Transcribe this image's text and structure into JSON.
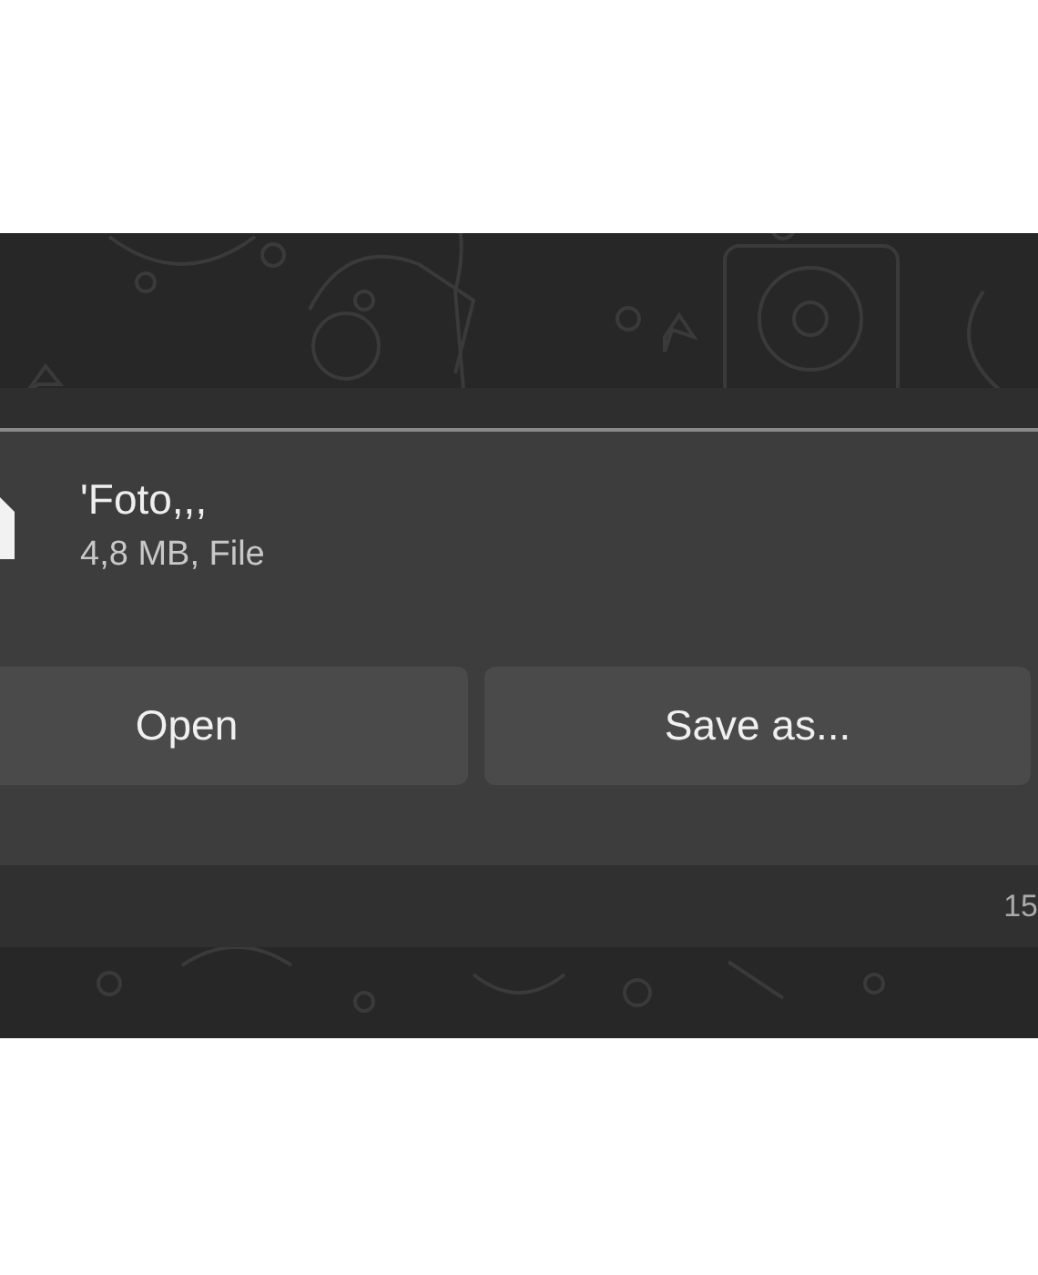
{
  "message": {
    "file_name": "'Foto,,,",
    "file_info": "4,8 MB, File",
    "buttons": [
      {
        "label": "Open"
      },
      {
        "label": "Save as..."
      }
    ],
    "time": "15"
  }
}
